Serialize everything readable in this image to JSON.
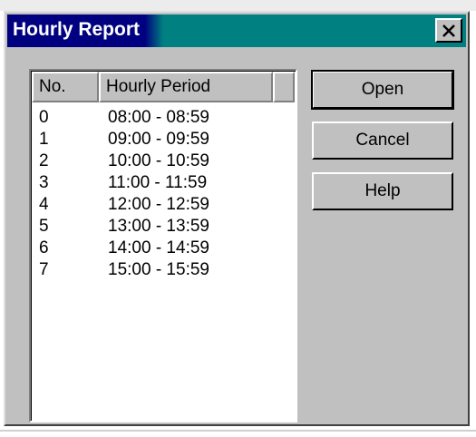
{
  "dialog": {
    "title": "Hourly Report",
    "close_label": "×"
  },
  "list": {
    "columns": [
      "No.",
      "Hourly Period"
    ],
    "rows": [
      {
        "no": "0",
        "period": "08:00 - 08:59"
      },
      {
        "no": "1",
        "period": "09:00 - 09:59"
      },
      {
        "no": "2",
        "period": "10:00 - 10:59"
      },
      {
        "no": "3",
        "period": "11:00 - 11:59"
      },
      {
        "no": "4",
        "period": "12:00 - 12:59"
      },
      {
        "no": "5",
        "period": "13:00 - 13:59"
      },
      {
        "no": "6",
        "period": "14:00 - 14:59"
      },
      {
        "no": "7",
        "period": "15:00 - 15:59"
      }
    ]
  },
  "buttons": {
    "open": "Open",
    "cancel": "Cancel",
    "help": "Help"
  },
  "colors": {
    "title_active": "#000080",
    "title_gradient": "#008080",
    "face": "#c0c0c0"
  }
}
